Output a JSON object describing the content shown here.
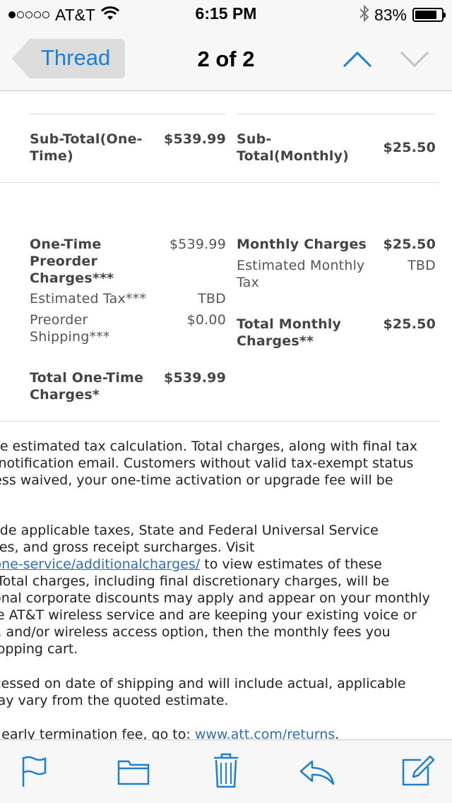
{
  "status_bar": {
    "carrier": "AT&T",
    "time": "6:15 PM",
    "battery": "83%",
    "battery_level": 0.83,
    "signal_bars": 1
  },
  "nav": {
    "back_label": "Thread",
    "title": "2 of 2"
  },
  "subtotals": {
    "one_time_label": "Sub-Total(One-\nTime)",
    "one_time_value": "$539.99",
    "monthly_label": "Sub-\nTotal(Monthly)",
    "monthly_value": "$25.50"
  },
  "charges": {
    "one_time_preorder_label": "One-Time\nPreorder\nCharges***",
    "one_time_preorder_value": "$539.99",
    "estimated_tax_label": "Estimated Tax***",
    "estimated_tax_value": "TBD",
    "preorder_shipping_label": "Preorder\nShipping***",
    "preorder_shipping_value": "$0.00",
    "total_one_time_label": "Total One-Time\nCharges*",
    "total_one_time_value": "$539.99",
    "monthly_charges_label": "Monthly Charges",
    "monthly_charges_value": "$25.50",
    "estimated_monthly_tax_label": "Estimated Monthly\nTax",
    "estimated_monthly_tax_value": "TBD",
    "total_monthly_label": "Total Monthly\nCharges**",
    "total_monthly_value": "$25.50"
  },
  "notes": {
    "p1": "clude estimated tax calculation. Total charges, along with final tax\nour notification email. Customers without valid tax-exempt status\nUnless waived, your one-time activation or upgrade fee will be",
    "p2_line1": "nclude applicable taxes, State and Federal Universal Service\ny Fees, and gross receipt surcharges. Visit",
    "p2_link": "/phone-service/additionalcharges/",
    "p2_after_link": " to view estimates of these",
    "p2_rest": "ea. Total charges, including final discretionary charges, will be\nditional corporate discounts may apply and appear on your monthly\nhave AT&T wireless service and are keeping your existing voice or\ntion, and/or wireless access option, then the monthly fees you\nr shopping cart.",
    "p3": "processed on date of shipping and will include actual, applicable\nn may vary from the quoted estimate.",
    "p4_text": "und early termination fee, go to: ",
    "p4_link": "www.att.com/returns",
    "p4_end": "."
  },
  "toolbar": {
    "icons": [
      "flag-icon",
      "folder-icon",
      "trash-icon",
      "reply-icon",
      "compose-icon"
    ]
  },
  "colors": {
    "accent": "#1a7fd6",
    "link": "#2a6ebd",
    "bar_bg": "#f7f7f7"
  }
}
